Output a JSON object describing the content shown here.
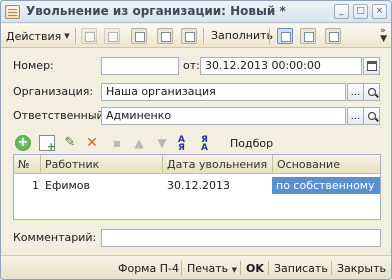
{
  "window": {
    "title": "Увольнение из организации: Новый *",
    "buttons": [
      "_",
      "□",
      "×"
    ]
  },
  "toolbar": {
    "actions_label": "Действия",
    "fill_label": "Заполнить"
  },
  "form": {
    "number_label": "Номер:",
    "number_value": "",
    "date_label": "от:",
    "date_value": "30.12.2013 00:00:00",
    "organization_label": "Организация:",
    "organization_value": "Наша организация",
    "responsible_label": "Ответственный:",
    "responsible_value": "Админенко",
    "ellipsis": "...",
    "comment_label": "Комментарий:",
    "comment_value": ""
  },
  "table_toolbar": {
    "sort_asc_text": "А Я",
    "sort_desc_text": "Я А",
    "select_label": "Подбор"
  },
  "table": {
    "columns": [
      "№",
      "Работник",
      "Дата увольнения",
      "Основание"
    ],
    "rows": [
      {
        "n": "1",
        "employee": "Ефимов",
        "date": "30.12.2013",
        "reason": "по собственному"
      }
    ]
  },
  "footer": {
    "form_label": "Форма П-4",
    "print_label": "Печать",
    "ok_label": "OK",
    "save_label": "Записать",
    "close_label": "Закрыть"
  }
}
